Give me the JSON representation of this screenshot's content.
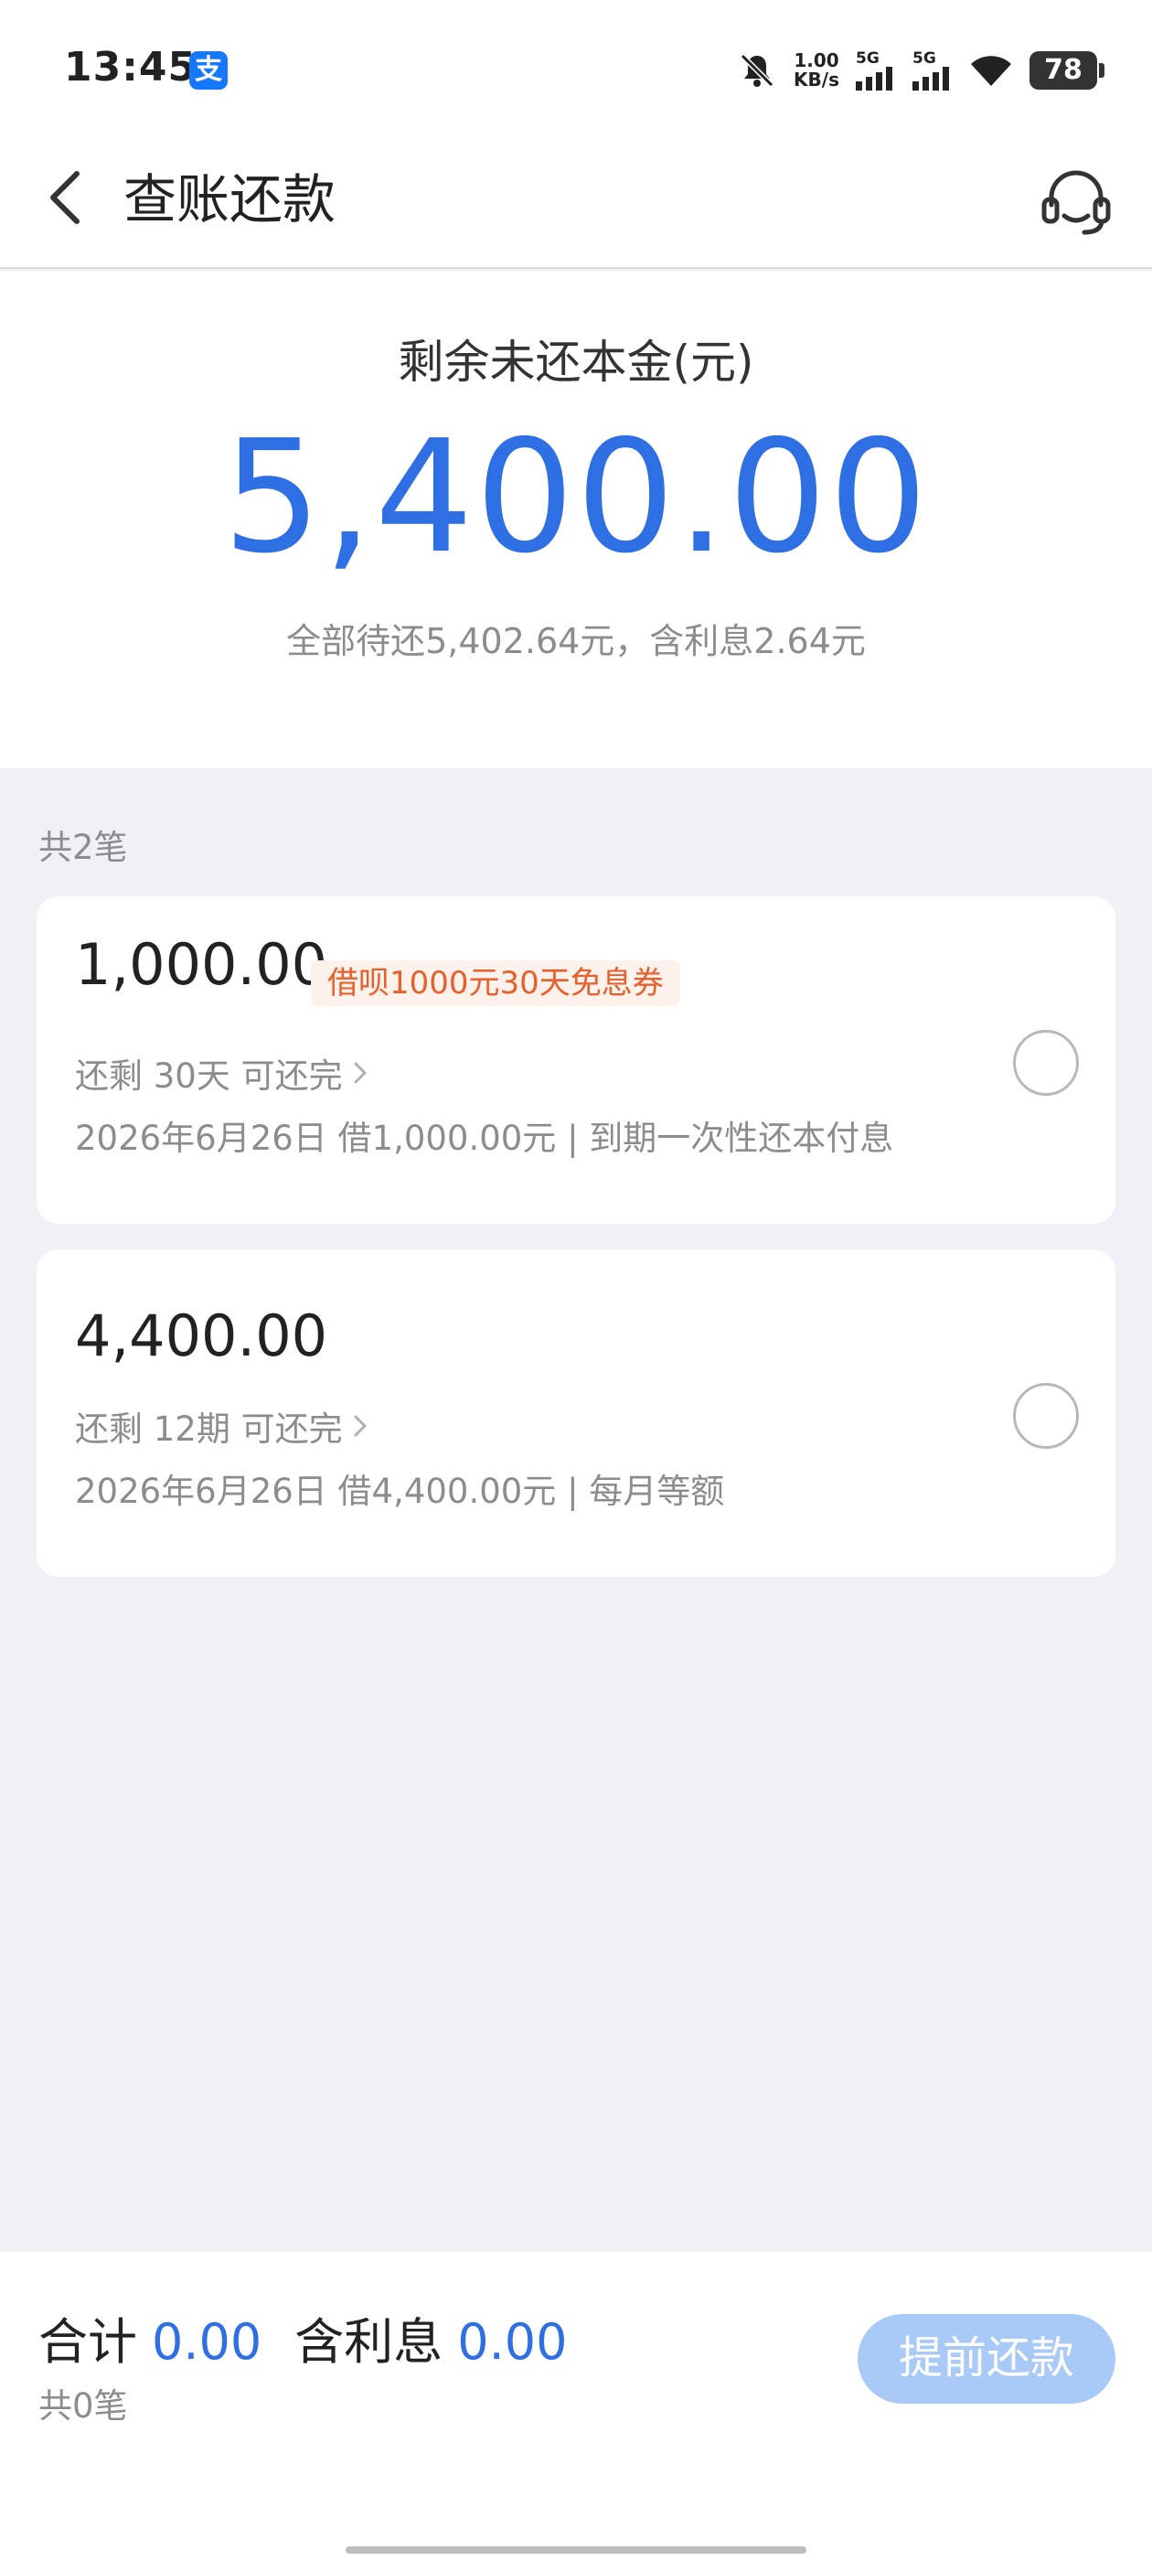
{
  "status_bar": {
    "time": "13:45",
    "app_badge": "支",
    "net_speed_value": "1.00",
    "net_speed_unit": "KB/s",
    "sim1_label": "5G",
    "sim2_label": "5G",
    "battery": "78"
  },
  "header": {
    "title": "查账还款",
    "back_icon": "chevron-left-icon",
    "service_icon": "headset-icon"
  },
  "summary": {
    "label": "剩余未还本金(元)",
    "amount": "5,400.00",
    "detail": "全部待还5,402.64元，含利息2.64元"
  },
  "list": {
    "count_label": "共2笔",
    "items": [
      {
        "amount": "1,000.00",
        "coupon": "借呗1000元30天免息券",
        "remain": "还剩 30天 可还完",
        "info": "2026年6月26日 借1,000.00元 | 到期一次性还本付息"
      },
      {
        "amount": "4,400.00",
        "remain": "还剩 12期 可还完",
        "info": "2026年6月26日 借4,400.00元 | 每月等额"
      }
    ]
  },
  "footer": {
    "total_label": "合计",
    "total_value": "0.00",
    "interest_label": "含利息",
    "interest_value": "0.00",
    "count": "共0笔",
    "prepay_button": "提前还款"
  },
  "colors": {
    "accent": "#2f6fe4",
    "coupon_text": "#e6602c",
    "coupon_bg": "#fdf1ec",
    "button_disabled": "#a9c9f6"
  }
}
